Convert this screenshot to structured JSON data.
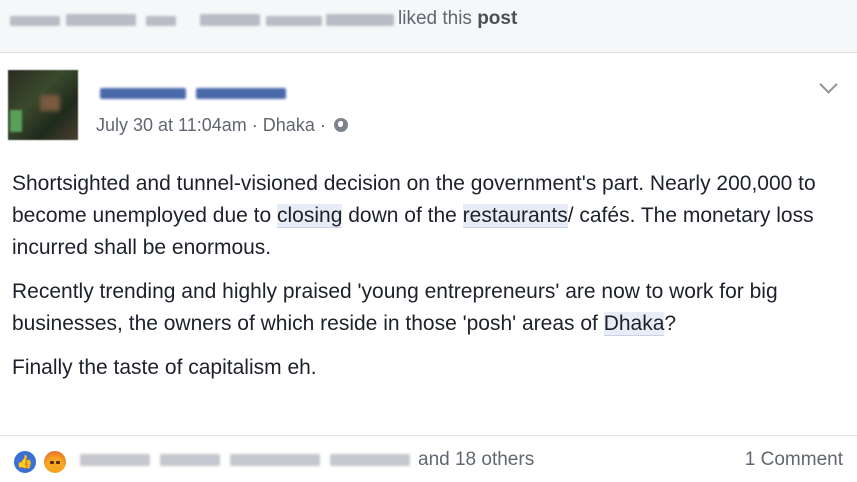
{
  "notification": {
    "liked_text": "liked this",
    "post_word": "post"
  },
  "post": {
    "timestamp": "July 30 at 11:04am",
    "separator": "·",
    "location": "Dhaka",
    "visibility_icon": "globe-icon",
    "paragraph1": {
      "part1": "Shortsighted and tunnel-visioned decision on the government's part. Nearly 200,000 to become unemployed due to ",
      "link1": "closing",
      "part2": " down of the ",
      "link2": "restaurants",
      "part3": "/ cafés. The monetary loss incurred shall be enormous."
    },
    "paragraph2": {
      "part1": "Recently trending and highly praised 'young entrepreneurs' are now to work for big businesses, the owners of which reside in those 'posh' areas of ",
      "link1": "Dhaka",
      "part2": "?"
    },
    "paragraph3": "Finally the taste of capitalism eh."
  },
  "footer": {
    "reactions": [
      "like-icon",
      "angry-icon"
    ],
    "others_text": "and 18 others",
    "comment_count": "1 Comment"
  },
  "colors": {
    "link_highlight": "#e7ecf6",
    "name_blue": "#4a69aa",
    "meta_gray": "#616770",
    "text": "#1d2129"
  }
}
